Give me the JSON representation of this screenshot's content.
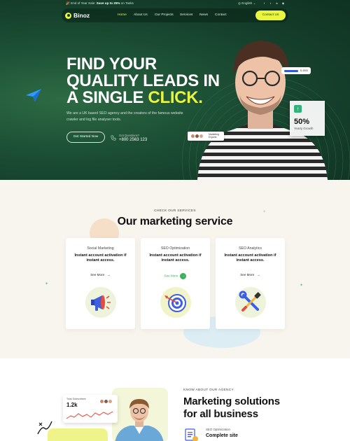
{
  "topbar": {
    "promo_prefix": "End of Year Sale: ",
    "promo_bold": "Save up to 25%",
    "promo_suffix": " on Tasks",
    "language": "English",
    "social_icons": [
      "facebook-icon",
      "twitter-icon",
      "linkedin-icon",
      "instagram-icon"
    ]
  },
  "nav": {
    "logo": "Binoz",
    "items": [
      "Home",
      "About Us",
      "Our Projects",
      "Services",
      "News",
      "Contact"
    ],
    "active_index": 0,
    "cta": "Contact Us"
  },
  "hero": {
    "headline_line1": "FIND YOUR",
    "headline_line2": "QUALITY LEADS IN",
    "headline_line3_prefix": "A SINGLE ",
    "headline_line3_highlight": "CLICK.",
    "description": "We are a UK based SEO agency and the creators of the famous website crawler and log file analyser tools.",
    "button": "Get Started Now",
    "phone_label": "Got Questions?",
    "phone_number": "+800 2563 123",
    "mini_ui_text": "$ 4500",
    "stat_value": "50%",
    "stat_label": "Yearly Growth",
    "experts_label": "Marketing Experts"
  },
  "services": {
    "kicker": "CHECK OUR SERVICES",
    "title": "Our marketing service",
    "cards": [
      {
        "category": "Social Marketing",
        "title": "Instant account activation if instant access.",
        "link": "See More",
        "icon": "megaphone-icon"
      },
      {
        "category": "SEO Optimization",
        "title": "Instant account activation if instant access.",
        "link": "See More",
        "icon": "target-icon"
      },
      {
        "category": "SEO Analytics",
        "title": "Instant account activation if instant access.",
        "link": "See More",
        "icon": "tools-icon"
      }
    ]
  },
  "about": {
    "kicker": "KNOW ABOUT OUR AGENCY",
    "title_line1": "Marketing solutions",
    "title_line2": "for all business",
    "subs_label": "Total Subscribers",
    "subs_value": "1.2k",
    "seo_label": "SEO Optimization",
    "seo_title": "Complete site"
  },
  "colors": {
    "hero_green": "#1d5136",
    "accent_yellow": "#e9f53f",
    "services_bg": "#f8f4ee",
    "link_green": "#39b15a"
  }
}
